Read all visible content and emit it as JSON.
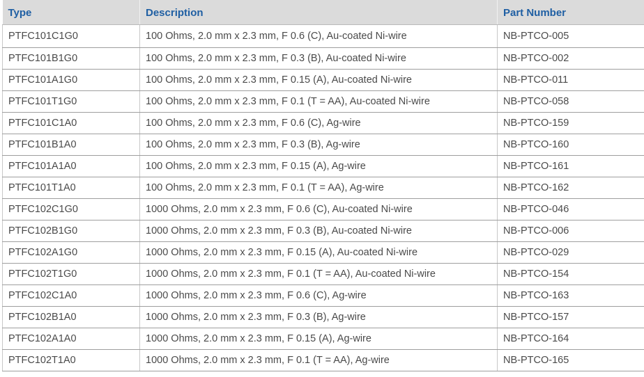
{
  "table": {
    "headers": {
      "type": "Type",
      "description": "Description",
      "part_number": "Part Number"
    },
    "rows": [
      {
        "type": "PTFC101C1G0",
        "description": "100 Ohms, 2.0 mm x 2.3 mm, F 0.6 (C), Au-coated Ni-wire",
        "part_number": "NB-PTCO-005"
      },
      {
        "type": "PTFC101B1G0",
        "description": "100 Ohms, 2.0 mm x 2.3 mm, F 0.3 (B), Au-coated Ni-wire",
        "part_number": "NB-PTCO-002"
      },
      {
        "type": "PTFC101A1G0",
        "description": "100 Ohms, 2.0 mm x 2.3 mm, F 0.15 (A), Au-coated Ni-wire",
        "part_number": "NB-PTCO-011"
      },
      {
        "type": "PTFC101T1G0",
        "description": "100 Ohms, 2.0 mm x 2.3 mm, F 0.1 (T = AA), Au-coated Ni-wire",
        "part_number": "NB-PTCO-058"
      },
      {
        "type": "PTFC101C1A0",
        "description": "100 Ohms, 2.0 mm x 2.3 mm, F 0.6 (C), Ag-wire",
        "part_number": "NB-PTCO-159"
      },
      {
        "type": "PTFC101B1A0",
        "description": "100 Ohms, 2.0 mm x 2.3 mm, F 0.3 (B), Ag-wire",
        "part_number": "NB-PTCO-160"
      },
      {
        "type": "PTFC101A1A0",
        "description": "100 Ohms, 2.0 mm x 2.3 mm, F 0.15 (A), Ag-wire",
        "part_number": "NB-PTCO-161"
      },
      {
        "type": "PTFC101T1A0",
        "description": "100 Ohms, 2.0 mm x 2.3 mm, F 0.1 (T = AA), Ag-wire",
        "part_number": "NB-PTCO-162"
      },
      {
        "type": "PTFC102C1G0",
        "description": "1000 Ohms, 2.0 mm x 2.3 mm, F 0.6 (C), Au-coated Ni-wire",
        "part_number": "NB-PTCO-046"
      },
      {
        "type": "PTFC102B1G0",
        "description": "1000 Ohms, 2.0 mm x 2.3 mm, F 0.3 (B), Au-coated Ni-wire",
        "part_number": "NB-PTCO-006"
      },
      {
        "type": "PTFC102A1G0",
        "description": "1000 Ohms, 2.0 mm x 2.3 mm, F 0.15 (A), Au-coated Ni-wire",
        "part_number": "NB-PTCO-029"
      },
      {
        "type": "PTFC102T1G0",
        "description": "1000 Ohms, 2.0 mm x 2.3 mm, F 0.1 (T = AA), Au-coated Ni-wire",
        "part_number": "NB-PTCO-154"
      },
      {
        "type": "PTFC102C1A0",
        "description": "1000 Ohms, 2.0 mm x 2.3 mm, F 0.6 (C), Ag-wire",
        "part_number": "NB-PTCO-163"
      },
      {
        "type": "PTFC102B1A0",
        "description": "1000 Ohms, 2.0 mm x 2.3 mm, F 0.3 (B), Ag-wire",
        "part_number": "NB-PTCO-157"
      },
      {
        "type": "PTFC102A1A0",
        "description": "1000 Ohms, 2.0 mm x 2.3 mm, F 0.15 (A), Ag-wire",
        "part_number": "NB-PTCO-164"
      },
      {
        "type": "PTFC102T1A0",
        "description": "1000 Ohms, 2.0 mm x 2.3 mm, F 0.1 (T = AA), Ag-wire",
        "part_number": "NB-PTCO-165"
      }
    ]
  },
  "colors": {
    "header_background": "#dbdbdb",
    "header_text": "#1f5fa3",
    "body_text": "#4a4a4a",
    "grid_lines": "#9e9e9e"
  }
}
